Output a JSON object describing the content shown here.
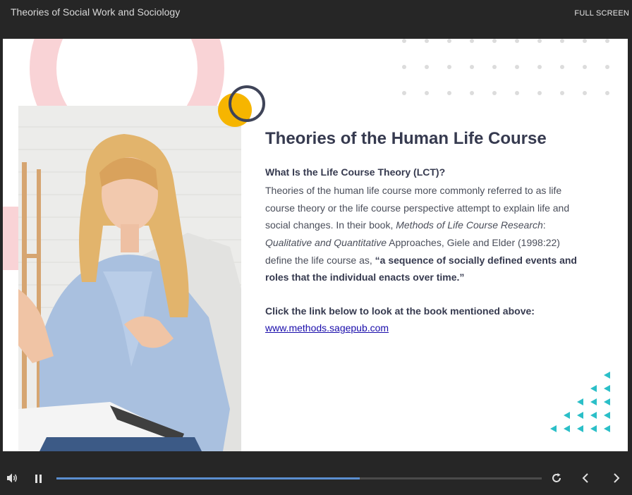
{
  "header": {
    "title": "Theories of Social Work and Sociology",
    "fullscreen_label": "FULL SCREEN"
  },
  "slide": {
    "heading": "Theories of the Human Life Course",
    "subheading": "What Is the Life Course Theory (LCT)?",
    "body": {
      "p1": "Theories of the human life course more commonly referred to as life course theory or the life course perspective attempt to explain life and social changes. In their book, ",
      "book_title": "Methods of Life Course Research",
      "colon": ": ",
      "book_subtitle": "Qualitative and Quantitative",
      "p2": " Approaches, Giele and Elder (1998:22) define the life course as, ",
      "quote": "“a sequence of socially defined events and roles that the individual enacts over time.”"
    },
    "link_lead": "Click the link below to look at the book mentioned above:",
    "link_text": "www.methods.sagepub.com"
  },
  "player": {
    "progress": 0.625
  },
  "icons": [
    "volume-icon",
    "pause-icon",
    "replay-icon",
    "previous-icon",
    "next-icon"
  ],
  "colors": {
    "accent_pink": "#f9d3d6",
    "accent_yellow": "#f6b500",
    "accent_teal": "#2bbfc8",
    "heading": "#363a4f",
    "progress": "#5b8ecf"
  }
}
